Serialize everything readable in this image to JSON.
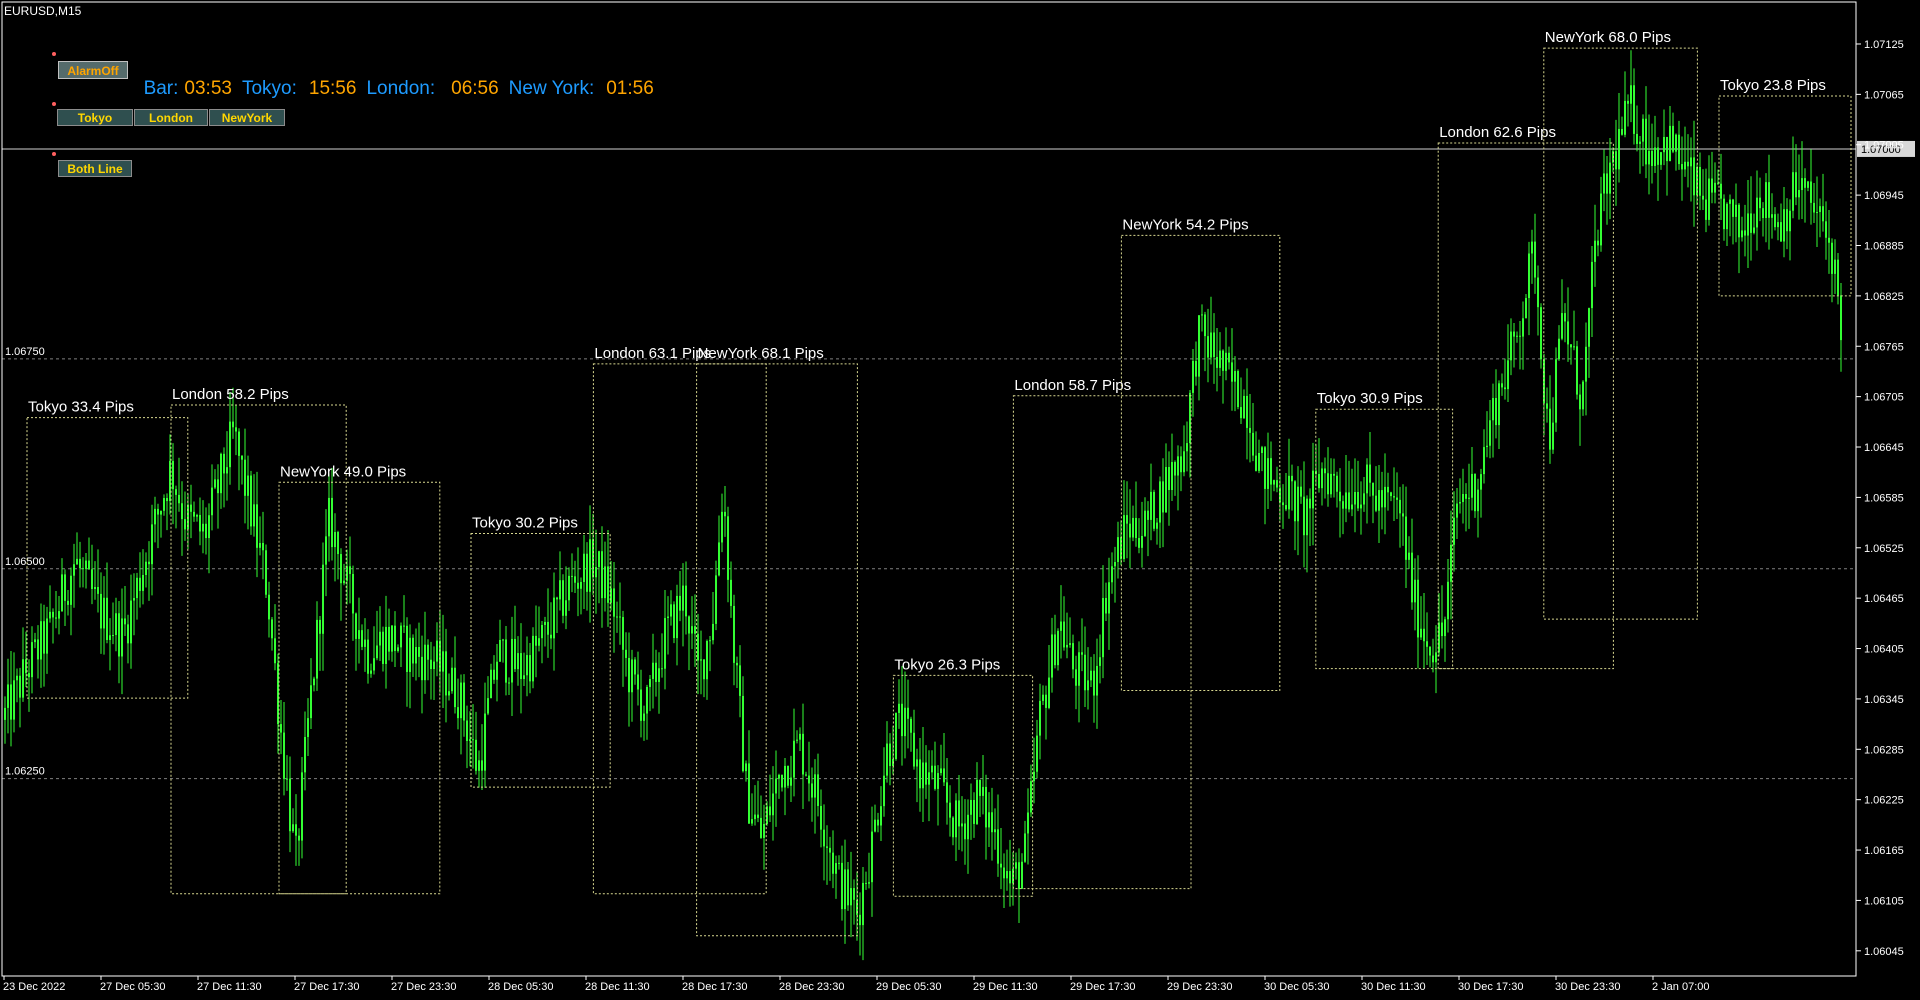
{
  "symbol_label": "EURUSD,M15",
  "buttons": {
    "alarm": "AlarmOff",
    "tokyo": "Tokyo",
    "london": "London",
    "newyork": "NewYork",
    "both_line": "Both Line"
  },
  "clock": {
    "bar_label": "Bar:",
    "bar_value": "03:53",
    "tokyo_label": "Tokyo:",
    "tokyo_value": "15:56",
    "london_label": "London:",
    "london_value": "06:56",
    "newyork_label": "New York:",
    "newyork_value": "01:56"
  },
  "colors": {
    "background": "#000000",
    "candle": "#33ff33",
    "axis": "#ffffff",
    "session_box": "#d8d890",
    "grid_dashed": "#808080",
    "label_blue": "#1E9BFF",
    "value_orange": "#FFA500"
  },
  "current_price": "1.07000",
  "chart_data": {
    "type": "line",
    "price_axis_ticks": [
      "1.07125",
      "1.07065",
      "1.07005",
      "1.06945",
      "1.06885",
      "1.06825",
      "1.06765",
      "1.06705",
      "1.06645",
      "1.06585",
      "1.06525",
      "1.06465",
      "1.06405",
      "1.06345",
      "1.06285",
      "1.06225",
      "1.06165",
      "1.06105",
      "1.06045"
    ],
    "horizontal_levels": [
      "1.06750",
      "1.06500",
      "1.06250"
    ],
    "time_axis_labels": [
      "23 Dec 2022",
      "27 Dec 05:30",
      "27 Dec 11:30",
      "27 Dec 17:30",
      "27 Dec 23:30",
      "28 Dec 05:30",
      "28 Dec 11:30",
      "28 Dec 17:30",
      "28 Dec 23:30",
      "29 Dec 05:30",
      "29 Dec 11:30",
      "29 Dec 17:30",
      "29 Dec 23:30",
      "30 Dec 05:30",
      "30 Dec 11:30",
      "30 Dec 17:30",
      "30 Dec 23:30",
      "2 Jan 07:00"
    ],
    "ylim": [
      1.06015,
      1.07175
    ],
    "sessions": [
      {
        "label": "Tokyo 33.4 Pips",
        "t0": 0.5,
        "t1": 3.85,
        "high": 1.0668,
        "low": 1.06346
      },
      {
        "label": "London 58.2 Pips",
        "t0": 3.5,
        "t1": 7.15,
        "high": 1.06695,
        "low": 1.06113
      },
      {
        "label": "NewYork 49.0 Pips",
        "t0": 5.75,
        "t1": 9.1,
        "high": 1.06603,
        "low": 1.06113
      },
      {
        "label": "Tokyo 30.2 Pips",
        "t0": 9.75,
        "t1": 12.65,
        "high": 1.06542,
        "low": 1.0624
      },
      {
        "label": "London 63.1 Pips",
        "t0": 12.3,
        "t1": 15.9,
        "high": 1.06744,
        "low": 1.06113
      },
      {
        "label": "NewYork 68.1 Pips",
        "t0": 14.45,
        "t1": 17.8,
        "high": 1.06744,
        "low": 1.06063
      },
      {
        "label": "Tokyo 26.3 Pips",
        "t0": 18.55,
        "t1": 21.45,
        "high": 1.06373,
        "low": 1.0611
      },
      {
        "label": "London 58.7 Pips",
        "t0": 21.05,
        "t1": 24.75,
        "high": 1.06706,
        "low": 1.06119
      },
      {
        "label": "NewYork 54.2 Pips",
        "t0": 23.3,
        "t1": 26.6,
        "high": 1.06897,
        "low": 1.06355
      },
      {
        "label": "Tokyo 30.9 Pips",
        "t0": 27.35,
        "t1": 30.2,
        "high": 1.0669,
        "low": 1.06381
      },
      {
        "label": "London 62.6 Pips",
        "t0": 29.9,
        "t1": 33.55,
        "high": 1.07007,
        "low": 1.06381
      },
      {
        "label": "NewYork 68.0 Pips",
        "t0": 32.1,
        "t1": 35.3,
        "high": 1.0712,
        "low": 1.0644
      },
      {
        "label": "Tokyo 23.8 Pips",
        "t0": 35.75,
        "t1": 38.5,
        "high": 1.07063,
        "low": 1.06825
      }
    ],
    "price_path": [
      [
        0.0,
        1.0632
      ],
      [
        0.5,
        1.0638
      ],
      [
        1.0,
        1.0643
      ],
      [
        1.5,
        1.0651
      ],
      [
        2.0,
        1.0645
      ],
      [
        2.5,
        1.0642
      ],
      [
        3.0,
        1.0652
      ],
      [
        3.5,
        1.0662
      ],
      [
        3.8,
        1.0656
      ],
      [
        4.2,
        1.0654
      ],
      [
        4.8,
        1.0666
      ],
      [
        5.2,
        1.0656
      ],
      [
        5.5,
        1.0648
      ],
      [
        5.8,
        1.063
      ],
      [
        6.1,
        1.0615
      ],
      [
        6.4,
        1.0634
      ],
      [
        6.8,
        1.0656
      ],
      [
        7.2,
        1.0647
      ],
      [
        7.6,
        1.064
      ],
      [
        8.0,
        1.0642
      ],
      [
        8.5,
        1.064
      ],
      [
        9.0,
        1.0639
      ],
      [
        9.5,
        1.0635
      ],
      [
        9.9,
        1.0626
      ],
      [
        10.3,
        1.064
      ],
      [
        10.8,
        1.0638
      ],
      [
        11.3,
        1.0642
      ],
      [
        11.8,
        1.0648
      ],
      [
        12.3,
        1.0651
      ],
      [
        12.7,
        1.0646
      ],
      [
        13.0,
        1.0638
      ],
      [
        13.4,
        1.0633
      ],
      [
        13.8,
        1.0642
      ],
      [
        14.2,
        1.0647
      ],
      [
        14.5,
        1.0637
      ],
      [
        14.8,
        1.0645
      ],
      [
        15.0,
        1.066
      ],
      [
        15.2,
        1.0642
      ],
      [
        15.5,
        1.0623
      ],
      [
        15.8,
        1.0618
      ],
      [
        16.2,
        1.0626
      ],
      [
        16.6,
        1.0629
      ],
      [
        17.0,
        1.0622
      ],
      [
        17.4,
        1.0613
      ],
      [
        17.8,
        1.0609
      ],
      [
        18.1,
        1.0617
      ],
      [
        18.4,
        1.0628
      ],
      [
        18.7,
        1.0632
      ],
      [
        19.1,
        1.0626
      ],
      [
        19.5,
        1.0624
      ],
      [
        19.9,
        1.0619
      ],
      [
        20.3,
        1.0623
      ],
      [
        20.7,
        1.0618
      ],
      [
        21.0,
        1.0612
      ],
      [
        21.3,
        1.0616
      ],
      [
        21.6,
        1.0632
      ],
      [
        22.0,
        1.0644
      ],
      [
        22.3,
        1.0638
      ],
      [
        22.7,
        1.0636
      ],
      [
        23.0,
        1.0648
      ],
      [
        23.4,
        1.0655
      ],
      [
        23.8,
        1.0655
      ],
      [
        24.2,
        1.066
      ],
      [
        24.6,
        1.0664
      ],
      [
        24.9,
        1.0678
      ],
      [
        25.2,
        1.0676
      ],
      [
        25.6,
        1.0672
      ],
      [
        25.9,
        1.067
      ],
      [
        26.2,
        1.0662
      ],
      [
        26.5,
        1.066
      ],
      [
        26.8,
        1.0659
      ],
      [
        27.1,
        1.0656
      ],
      [
        27.5,
        1.0662
      ],
      [
        27.9,
        1.0659
      ],
      [
        28.3,
        1.066
      ],
      [
        28.7,
        1.0658
      ],
      [
        29.1,
        1.0657
      ],
      [
        29.4,
        1.0646
      ],
      [
        29.7,
        1.0641
      ],
      [
        30.0,
        1.0642
      ],
      [
        30.3,
        1.0658
      ],
      [
        30.7,
        1.066
      ],
      [
        31.1,
        1.067
      ],
      [
        31.5,
        1.0677
      ],
      [
        31.9,
        1.0688
      ],
      [
        32.2,
        1.0665
      ],
      [
        32.5,
        1.068
      ],
      [
        32.9,
        1.067
      ],
      [
        33.2,
        1.069
      ],
      [
        33.5,
        1.0698
      ],
      [
        33.9,
        1.0705
      ],
      [
        34.3,
        1.07
      ],
      [
        34.7,
        1.0701
      ],
      [
        35.1,
        1.0697
      ],
      [
        35.4,
        1.0694
      ],
      [
        35.8,
        1.0693
      ],
      [
        36.2,
        1.069
      ],
      [
        36.6,
        1.0695
      ],
      [
        37.0,
        1.0691
      ],
      [
        37.4,
        1.0696
      ],
      [
        37.8,
        1.0692
      ],
      [
        38.1,
        1.0688
      ],
      [
        38.3,
        1.0679
      ]
    ]
  }
}
